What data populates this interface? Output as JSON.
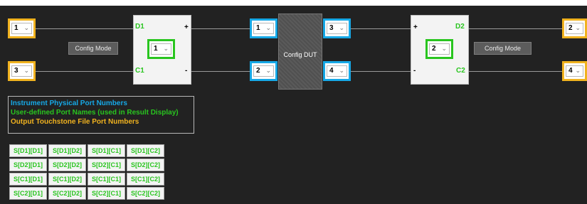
{
  "selectors": {
    "left_top": "1",
    "left_bottom": "3",
    "d1_name": "1",
    "dut_in_top": "1",
    "dut_in_bottom": "2",
    "dut_out_top": "3",
    "dut_out_bottom": "4",
    "d2_name": "2",
    "right_top": "2",
    "right_bottom": "4"
  },
  "chevron": "⌄",
  "ports": {
    "d1": "D1",
    "c1": "C1",
    "d2": "D2",
    "c2": "C2",
    "plus": "+",
    "minus": "-"
  },
  "buttons": {
    "config_mode_left": "Config Mode",
    "config_dut": "Config DUT",
    "config_mode_right": "Config Mode"
  },
  "legend": {
    "physical": "Instrument Physical Port Numbers",
    "user_defined": "User-defined Port Names (used in Result Display)",
    "touchstone": "Output Touchstone File Port Numbers"
  },
  "colors": {
    "physical": "#16a8e6",
    "user_defined": "#29c51f",
    "touchstone": "#f0b21f",
    "background": "#222222"
  },
  "sparams": [
    [
      "S[D1][D1]",
      "S[D1][D2]",
      "S[D1][C1]",
      "S[D1][C2]"
    ],
    [
      "S[D2][D1]",
      "S[D2][D2]",
      "S[D2][C1]",
      "S[D2][C2]"
    ],
    [
      "S[C1][D1]",
      "S[C1][D2]",
      "S[C1][C1]",
      "S[C1][C2]"
    ],
    [
      "S[C2][D1]",
      "S[C2][D2]",
      "S[C2][C1]",
      "S[C2][C2]"
    ]
  ]
}
